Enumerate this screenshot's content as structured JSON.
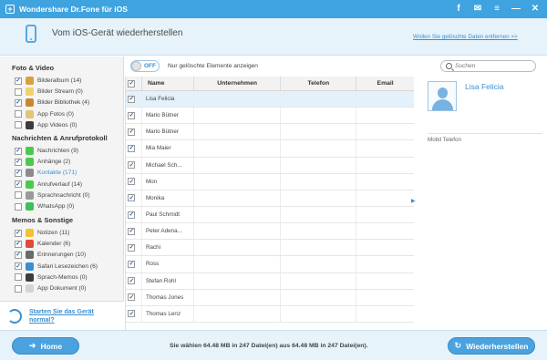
{
  "titlebar": {
    "title": "Wondershare Dr.Fone für iOS",
    "app_icon": "+",
    "icons": [
      "facebook-icon",
      "feedback-icon",
      "menu-icon",
      "minimize-icon",
      "close-icon"
    ]
  },
  "header": {
    "title": "Vom iOS-Gerät wiederherstellen",
    "link": "Wollen Sie gelöschte Daten entfernen >>"
  },
  "sidebar": {
    "sections": [
      {
        "title": "Foto & Video",
        "items": [
          {
            "label": "Bilderalbum (14)",
            "checked": true,
            "icon": "photo-album-icon",
            "icon_color": "#d9a03f"
          },
          {
            "label": "Bilder Stream (0)",
            "checked": false,
            "icon": "photo-stream-icon",
            "icon_color": "#f0d26a"
          },
          {
            "label": "Bilder Bibliothek (4)",
            "checked": true,
            "icon": "photo-library-icon",
            "icon_color": "#c9872e"
          },
          {
            "label": "App Fotos (0)",
            "checked": false,
            "icon": "app-photos-icon",
            "icon_color": "#e2c57a"
          },
          {
            "label": "App Videos (0)",
            "checked": false,
            "icon": "app-videos-icon",
            "icon_color": "#3c3c3c"
          }
        ]
      },
      {
        "title": "Nachrichten & Anrufprotokoll",
        "items": [
          {
            "label": "Nachrichten (9)",
            "checked": true,
            "icon": "messages-icon",
            "icon_color": "#4cc94c"
          },
          {
            "label": "Anhänge (2)",
            "checked": true,
            "icon": "attachments-icon",
            "icon_color": "#4cc94c"
          },
          {
            "label": "Kontakte (171)",
            "checked": true,
            "icon": "contacts-icon",
            "icon_color": "#8c8c8c",
            "active": true
          },
          {
            "label": "Anrufverlauf (14)",
            "checked": true,
            "icon": "call-history-icon",
            "icon_color": "#4cc94c"
          },
          {
            "label": "Sprachnachricht (0)",
            "checked": false,
            "icon": "voicemail-icon",
            "icon_color": "#9a9a9a"
          },
          {
            "label": "WhatsApp (0)",
            "checked": false,
            "icon": "whatsapp-icon",
            "icon_color": "#3fbf5a"
          }
        ]
      },
      {
        "title": "Memos & Sonstige",
        "items": [
          {
            "label": "Notizen (11)",
            "checked": true,
            "icon": "notes-icon",
            "icon_color": "#f2c230"
          },
          {
            "label": "Kalender (6)",
            "checked": true,
            "icon": "calendar-icon",
            "icon_color": "#e04a3a"
          },
          {
            "label": "Erinnerungen (10)",
            "checked": true,
            "icon": "reminders-icon",
            "icon_color": "#6a6a6a"
          },
          {
            "label": "Safari Lesezeichen (6)",
            "checked": true,
            "icon": "safari-icon",
            "icon_color": "#3a8fd1"
          },
          {
            "label": "Sprach-Memos (0)",
            "checked": false,
            "icon": "voice-memos-icon",
            "icon_color": "#3c3c3c"
          },
          {
            "label": "App Dokument (0)",
            "checked": false,
            "icon": "app-document-icon",
            "icon_color": "#d4d4d4"
          }
        ]
      }
    ],
    "restart_link": "Starten Sie das Gerät normal?"
  },
  "main": {
    "toggle_label": "OFF",
    "toggle_desc": "Nur gelöschte Elemente anzeigen",
    "search_placeholder": "Suchen",
    "columns": {
      "name": "Name",
      "unternehmen": "Unternehmen",
      "telefon": "Telefon",
      "email": "Email"
    },
    "rows": [
      {
        "name": "Lisa Felicia",
        "checked": true,
        "selected": true
      },
      {
        "name": "Mario Bütner",
        "checked": true
      },
      {
        "name": "Mario Bütner",
        "checked": true
      },
      {
        "name": "Mia Maier",
        "checked": true
      },
      {
        "name": "Michael Sch...",
        "checked": true
      },
      {
        "name": "Mon",
        "checked": true
      },
      {
        "name": "Monika",
        "checked": true
      },
      {
        "name": "Paul Schmidt",
        "checked": true
      },
      {
        "name": "Peter Adena...",
        "checked": true
      },
      {
        "name": "Rachi",
        "checked": true
      },
      {
        "name": "Ross",
        "checked": true
      },
      {
        "name": "Stefan Rohl",
        "checked": true
      },
      {
        "name": "Thomas Jones",
        "checked": true
      },
      {
        "name": "Thomas Lenz",
        "checked": true
      }
    ]
  },
  "detail": {
    "name": "Lisa Felicia",
    "mobile_label": "Mobil Telefon"
  },
  "footer": {
    "home_label": "Home",
    "status": "Sie wählen 64.48 MB in 247 Datei(en) aus 64.48 MB in 247 Datei(en).",
    "restore_label": "Wiederherstellen"
  }
}
